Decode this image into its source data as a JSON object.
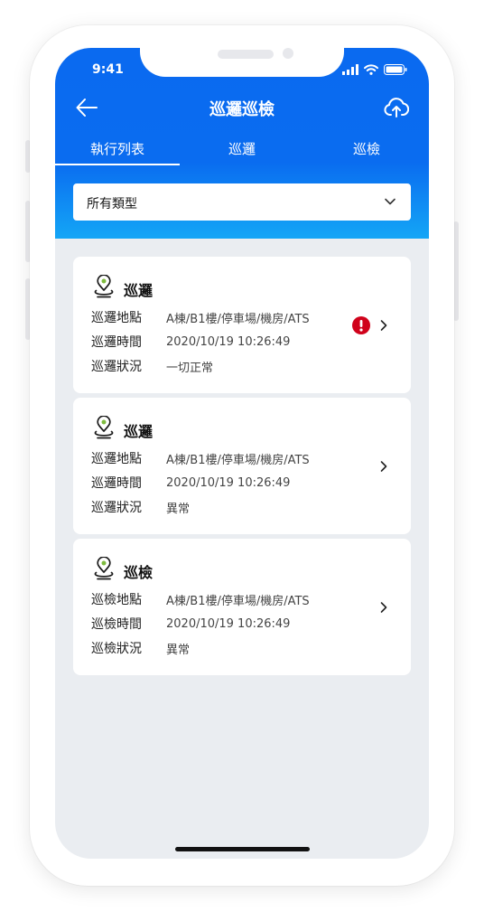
{
  "status": {
    "time": "9:41"
  },
  "header": {
    "title": "巡邏巡檢"
  },
  "tabs": [
    {
      "label": "執行列表"
    },
    {
      "label": "巡邏"
    },
    {
      "label": "巡檢"
    }
  ],
  "filter": {
    "selected": "所有類型"
  },
  "cards": [
    {
      "title": "巡邏",
      "rows": [
        {
          "label": "巡邏地點",
          "value": "A棟/B1樓/停車場/機房/ATS"
        },
        {
          "label": "巡邏時間",
          "value": "2020/10/19 10:26:49"
        },
        {
          "label": "巡邏狀況",
          "value": "一切正常"
        }
      ],
      "alert": true
    },
    {
      "title": "巡邏",
      "rows": [
        {
          "label": "巡邏地點",
          "value": "A棟/B1樓/停車場/機房/ATS"
        },
        {
          "label": "巡邏時間",
          "value": "2020/10/19 10:26:49"
        },
        {
          "label": "巡邏狀況",
          "value": "異常"
        }
      ],
      "alert": false
    },
    {
      "title": "巡檢",
      "rows": [
        {
          "label": "巡檢地點",
          "value": "A棟/B1樓/停車場/機房/ATS"
        },
        {
          "label": "巡檢時間",
          "value": "2020/10/19 10:26:49"
        },
        {
          "label": "巡檢狀況",
          "value": "異常"
        }
      ],
      "alert": false
    }
  ],
  "colors": {
    "primary": "#0a6cf0",
    "gradient_end": "#14a6f6",
    "background": "#eaedf1",
    "alert": "#d0021b"
  },
  "icons": {
    "back": "arrow-left-icon",
    "upload": "cloud-upload-icon",
    "dropdown": "chevron-down-icon",
    "location": "location-pin-icon",
    "alert": "exclamation-circle-icon",
    "detail": "chevron-right-icon"
  }
}
